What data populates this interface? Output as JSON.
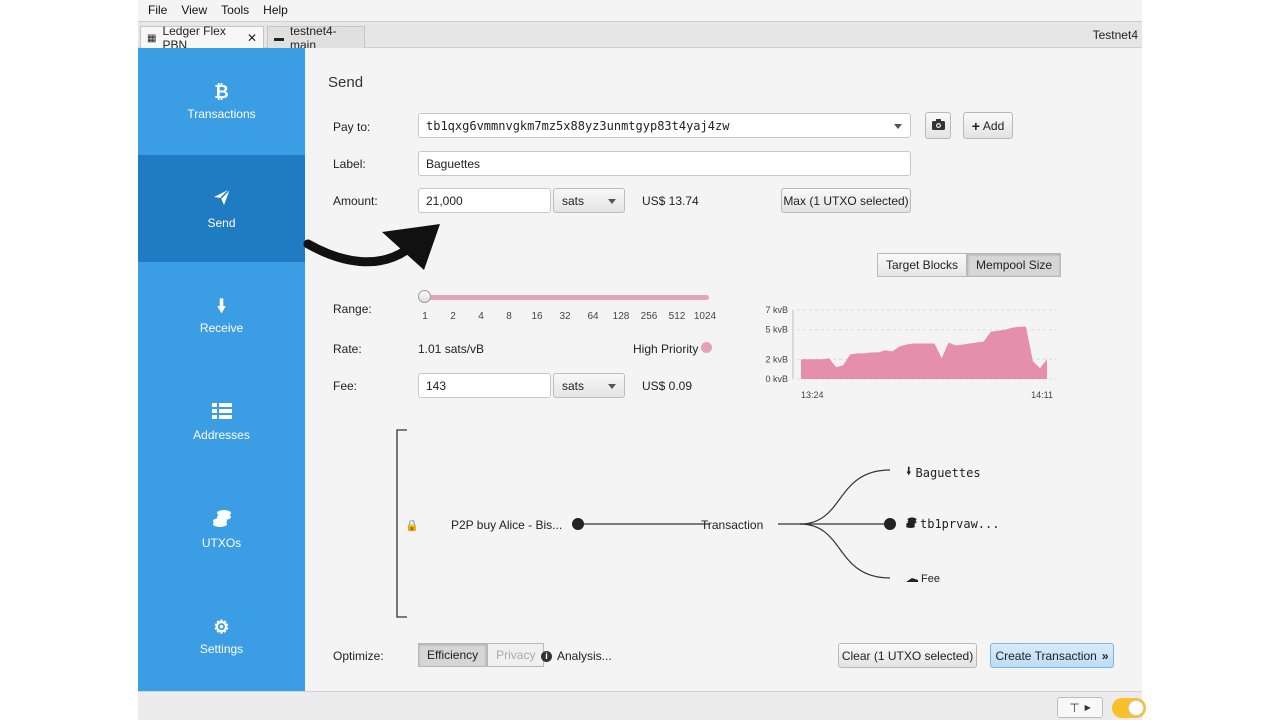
{
  "menu": [
    "File",
    "View",
    "Tools",
    "Help"
  ],
  "tabs": [
    {
      "label": "Ledger Flex PBN",
      "icon": "wallet-icon",
      "active": true
    },
    {
      "label": "testnet4-main",
      "icon": "wallet-icon",
      "active": false
    }
  ],
  "network_label": "Testnet4",
  "sidebar": {
    "items": [
      {
        "label": "Transactions",
        "icon": "bitcoin-icon"
      },
      {
        "label": "Send",
        "icon": "send-icon"
      },
      {
        "label": "Receive",
        "icon": "receive-icon"
      },
      {
        "label": "Addresses",
        "icon": "addresses-icon"
      },
      {
        "label": "UTXOs",
        "icon": "coins-icon"
      },
      {
        "label": "Settings",
        "icon": "gear-icon"
      }
    ],
    "active": "Send"
  },
  "send": {
    "title": "Send",
    "pay_to_label": "Pay to:",
    "pay_to_value": "tb1qxg6vmmnvgkm7mz5x88yz3unmtgyp83t4yaj4zw",
    "add_label": "Add",
    "label_label": "Label:",
    "label_value": "Baguettes",
    "amount_label": "Amount:",
    "amount_value": "21,000",
    "amount_unit": "sats",
    "amount_fiat": "US$ 13.74",
    "max_label": "Max (1 UTXO selected)",
    "fee_tabs": [
      "Target Blocks",
      "Mempool Size"
    ],
    "fee_tab_selected": "Mempool Size",
    "range_label": "Range:",
    "range_ticks": [
      "1",
      "2",
      "4",
      "8",
      "16",
      "32",
      "64",
      "128",
      "256",
      "512",
      "1024"
    ],
    "range_value": 1,
    "rate_label": "Rate:",
    "rate_value": "1.01 sats/vB",
    "priority_label": "High Priority",
    "priority_color": "#e6a1b6",
    "fee_label": "Fee:",
    "fee_value": "143",
    "fee_unit": "sats",
    "fee_fiat": "US$ 0.09"
  },
  "chart_data": {
    "type": "area",
    "y_tick_labels": [
      "7 kvB",
      "5 kvB",
      "2 kvB",
      "0 kvB"
    ],
    "x_tick_labels": [
      "13:24",
      "14:11"
    ],
    "ylim": [
      0,
      7
    ],
    "color": "#e68fac",
    "values": [
      2.0,
      2.0,
      2.0,
      2.0,
      2.1,
      1.2,
      1.4,
      2.5,
      2.6,
      2.6,
      2.7,
      2.7,
      2.9,
      2.8,
      3.3,
      3.5,
      3.6,
      3.6,
      3.6,
      3.6,
      2.1,
      3.7,
      3.4,
      3.5,
      3.6,
      3.7,
      3.8,
      4.8,
      4.9,
      5.0,
      5.2,
      5.3,
      5.3,
      1.8,
      1.1,
      2.0
    ]
  },
  "diagram": {
    "input_label": "P2P buy Alice - Bis...",
    "tx_label": "Transaction",
    "outputs": [
      {
        "label": "Baguettes",
        "icon": "receive-arrow-icon"
      },
      {
        "label": "tb1prvaw...",
        "icon": "coins-icon"
      },
      {
        "label": "Fee",
        "icon": "fee-icon"
      }
    ]
  },
  "optimize": {
    "label": "Optimize:",
    "options": [
      "Efficiency",
      "Privacy"
    ],
    "selected": "Efficiency",
    "analysis_label": "Analysis...",
    "clear_label": "Clear (1 UTXO selected)",
    "create_label": "Create Transaction"
  }
}
